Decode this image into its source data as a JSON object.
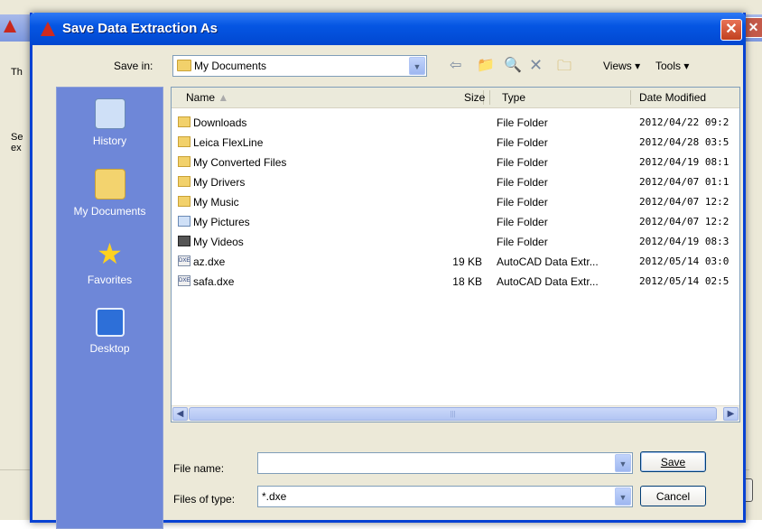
{
  "background_window": {
    "text_t": "Th",
    "text_s": "Se",
    "text_e": "ex"
  },
  "dialog": {
    "title": "Save Data Extraction As",
    "close_label": "✕"
  },
  "toolbar": {
    "save_in_label": "Save in:",
    "save_in_value": "My Documents",
    "back_icon": "back-arrow-icon",
    "up_folder_icon": "up-folder-icon",
    "search_icon": "search-web-icon",
    "delete_icon": "delete-icon",
    "new_folder_icon": "new-folder-icon",
    "views_label": "Views",
    "tools_label": "Tools"
  },
  "places": [
    {
      "label": "History",
      "icon": "history-icon"
    },
    {
      "label": "My Documents",
      "icon": "my-documents-icon"
    },
    {
      "label": "Favorites",
      "icon": "favorites-star-icon"
    },
    {
      "label": "Desktop",
      "icon": "desktop-icon"
    }
  ],
  "list": {
    "columns": {
      "name": "Name",
      "size": "Size",
      "type": "Type",
      "date": "Date Modified"
    },
    "rows": [
      {
        "name": "Downloads",
        "size": "",
        "type": "File Folder",
        "date": "2012/04/22 09:2",
        "icon": "folder"
      },
      {
        "name": "Leica FlexLine",
        "size": "",
        "type": "File Folder",
        "date": "2012/04/28 03:5",
        "icon": "folder"
      },
      {
        "name": "My Converted Files",
        "size": "",
        "type": "File Folder",
        "date": "2012/04/19 08:1",
        "icon": "folder"
      },
      {
        "name": "My Drivers",
        "size": "",
        "type": "File Folder",
        "date": "2012/04/07 01:1",
        "icon": "folder"
      },
      {
        "name": "My Music",
        "size": "",
        "type": "File Folder",
        "date": "2012/04/07 12:2",
        "icon": "music"
      },
      {
        "name": "My Pictures",
        "size": "",
        "type": "File Folder",
        "date": "2012/04/07 12:2",
        "icon": "pictures"
      },
      {
        "name": "My Videos",
        "size": "",
        "type": "File Folder",
        "date": "2012/04/19 08:3",
        "icon": "videos"
      },
      {
        "name": "az.dxe",
        "size": "19 KB",
        "type": "AutoCAD Data Extr...",
        "date": "2012/05/14 03:0",
        "icon": "dxe"
      },
      {
        "name": "safa.dxe",
        "size": "18 KB",
        "type": "AutoCAD Data Extr...",
        "date": "2012/05/14 02:5",
        "icon": "dxe"
      }
    ]
  },
  "footer": {
    "file_name_label": "File name:",
    "file_name_value": "",
    "files_of_type_label": "Files of type:",
    "files_of_type_value": "*.dxe",
    "save_label": "Save",
    "cancel_label": "Cancel"
  },
  "colors": {
    "title_bar": "#0556e3",
    "places_bar": "#6e87d8",
    "dialog_bg": "#ece9d8"
  }
}
